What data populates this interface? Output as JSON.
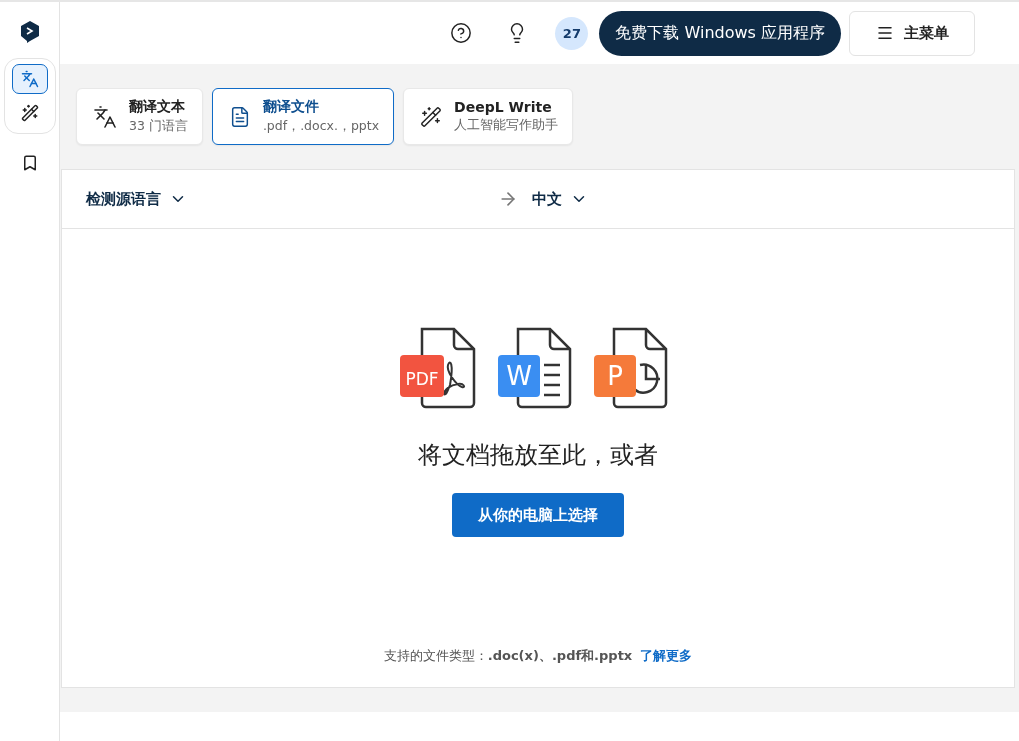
{
  "sidebar": {
    "items": [
      {
        "kind": "translate",
        "selected": true
      },
      {
        "kind": "write",
        "selected": false
      },
      {
        "kind": "bookmark",
        "selected": false
      }
    ]
  },
  "header": {
    "badge": "27",
    "download_button": "免费下载 Windows 应用程序",
    "menu_button": "主菜单"
  },
  "tabs": [
    {
      "kind": "text",
      "title": "翻译文本",
      "subtitle": "33 门语言",
      "selected": false
    },
    {
      "kind": "file",
      "title": "翻译文件",
      "subtitle": ".pdf，.docx.，pptx",
      "selected": true
    },
    {
      "kind": "write",
      "title": "DeepL Write",
      "subtitle": "人工智能写作助手",
      "selected": false
    }
  ],
  "languages": {
    "source": "检测源语言",
    "target": "中文"
  },
  "file_types": [
    {
      "kind": "pdf",
      "label": "PDF",
      "color": "#f25440"
    },
    {
      "kind": "word",
      "label": "W",
      "color": "#3a8ef2"
    },
    {
      "kind": "powerpoint",
      "label": "P",
      "color": "#f57a3a"
    }
  ],
  "drop_text": "将文档拖放至此，或者",
  "choose_button": "从你的电脑上选择",
  "supported": {
    "text": "支持的文件类型：**.doc(x)、.pdf和.pptx**",
    "link": "了解更多"
  }
}
